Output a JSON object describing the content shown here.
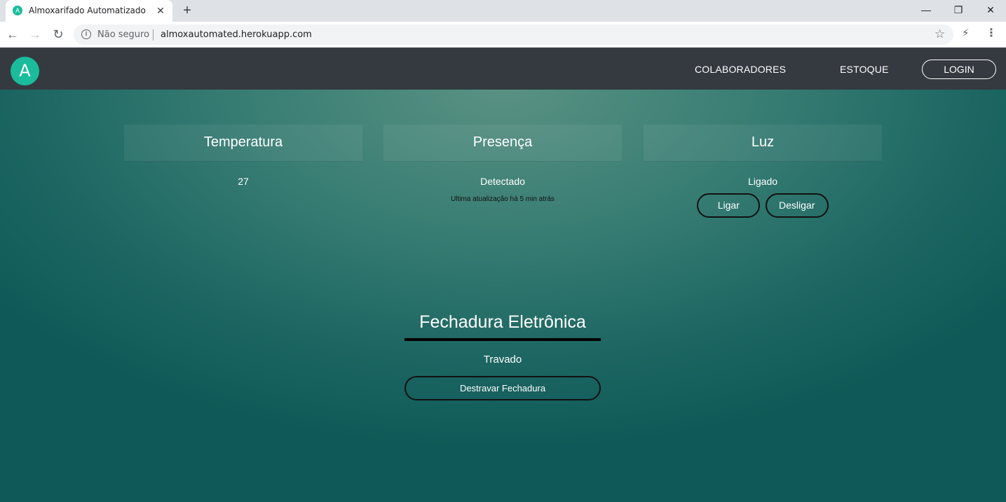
{
  "browser": {
    "tab_title": "Almoxarifado Automatizado",
    "tab_favicon_letter": "A",
    "new_tab": "+",
    "close_tab": "✕",
    "security_label": "Não seguro",
    "url": "almoxautomated.herokuapp.com",
    "icons": [
      "back-icon",
      "forward-icon",
      "reload-icon",
      "info-icon",
      "star-icon",
      "extension-icon",
      "menu-icon",
      "minimize-icon",
      "restore-icon",
      "close-window-icon"
    ]
  },
  "navbar": {
    "logo_letter": "A",
    "links": [
      "COLABORADORES",
      "ESTOQUE"
    ],
    "login_label": "LOGIN",
    "logo_color": "#1abc9c",
    "background": "#343a40"
  },
  "cards": {
    "temperatura": {
      "title": "Temperatura",
      "value": "27"
    },
    "presenca": {
      "title": "Presença",
      "value": "Detectado",
      "note": "Ultima atualização há 5 min atrás"
    },
    "luz": {
      "title": "Luz",
      "value": "Ligado",
      "on_label": "Ligar",
      "off_label": "Desligar"
    }
  },
  "lock": {
    "title": "Fechadura Eletrônica",
    "status": "Travado",
    "button_label": "Destravar Fechadura"
  }
}
